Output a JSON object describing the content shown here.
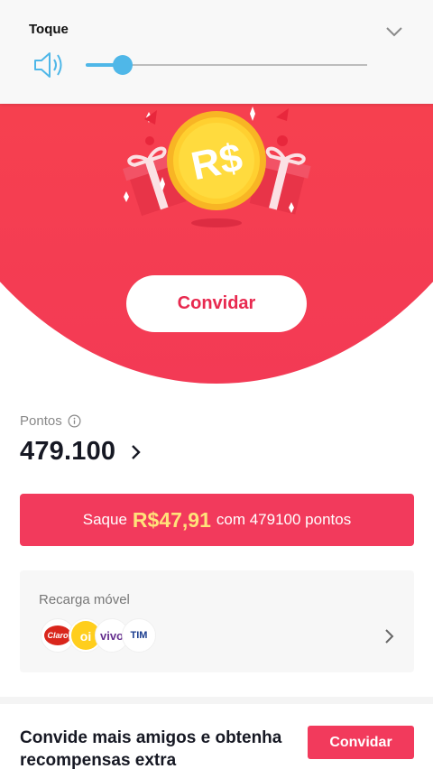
{
  "volume_panel": {
    "title": "Toque",
    "level": 0.13,
    "accent_color": "#4fb7e8",
    "speaker_icon": "speaker-icon",
    "collapse_icon": "chevron-down-icon"
  },
  "hero": {
    "coin_label": "R$",
    "invite_label": "Convidar",
    "background_color": "#f4424f"
  },
  "points": {
    "label": "Pontos",
    "value": "479.100",
    "info_icon": "info-icon"
  },
  "withdraw": {
    "prefix": "Saque",
    "amount": "R$47,91",
    "suffix": "com 479100 pontos",
    "color": "#f23a5c",
    "amount_color": "#ffe27a"
  },
  "recharge": {
    "title": "Recarga móvel",
    "carriers": [
      "Claro",
      "oi",
      "vivo",
      "TIM"
    ]
  },
  "footer": {
    "text": "Convide mais amigos e obtenha recompensas extra",
    "button_label": "Convidar"
  }
}
